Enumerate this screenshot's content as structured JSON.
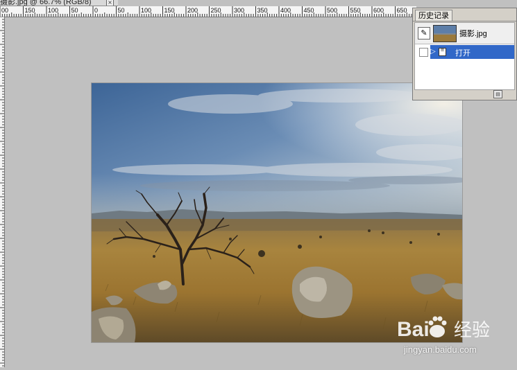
{
  "document": {
    "tab_title": "摄影.jpg @ 66.7% (RGB/8)",
    "close_glyph": "×"
  },
  "ruler": {
    "horizontal_labels": [
      "00",
      "150",
      "100",
      "50",
      "0",
      "50",
      "100",
      "150",
      "200",
      "250",
      "300",
      "350",
      "400",
      "450",
      "500",
      "550",
      "600",
      "650"
    ]
  },
  "history_panel": {
    "tab_label": "历史记录",
    "snapshot": {
      "name": "摄影.jpg",
      "brush_icon": "history-brush-icon"
    },
    "steps": [
      {
        "label": "打开",
        "icon": "open-document-icon",
        "selected": true
      }
    ],
    "delete_glyph": "▤"
  },
  "watermark": {
    "brand_text": "Bai",
    "brand_text_2": "经验",
    "url": "jingyan.baidu.com"
  }
}
